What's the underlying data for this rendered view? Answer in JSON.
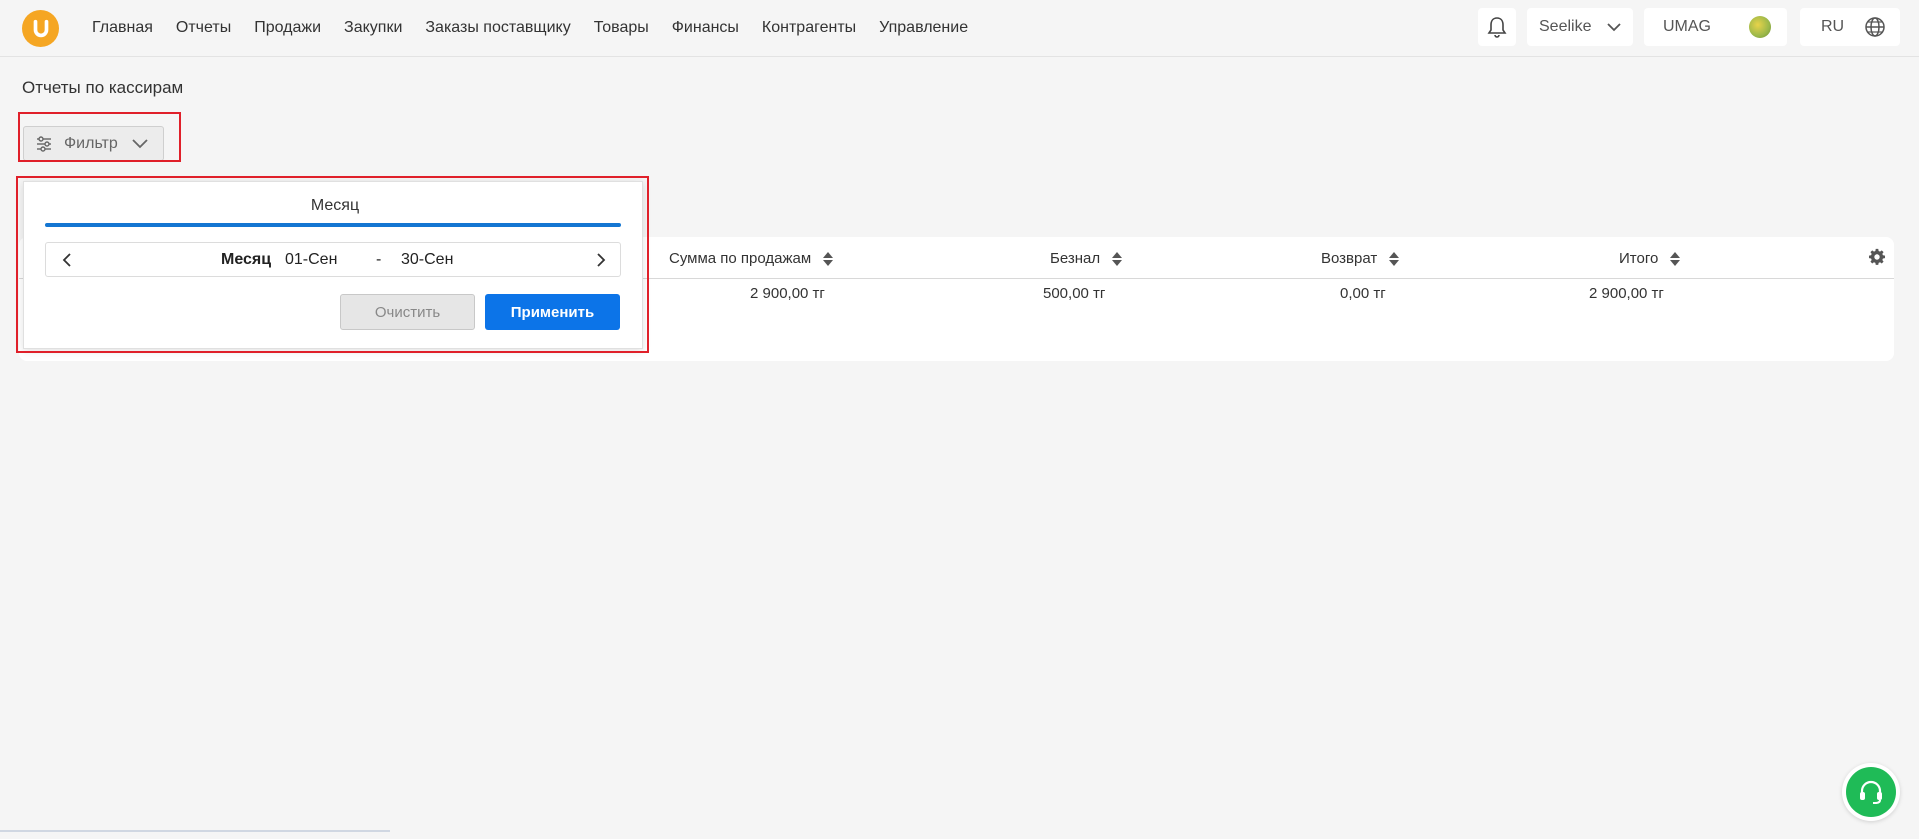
{
  "header": {
    "logo": "umag-logo",
    "nav": [
      "Главная",
      "Отчеты",
      "Продажи",
      "Закупки",
      "Заказы поставщику",
      "Товары",
      "Финансы",
      "Контрагенты",
      "Управление"
    ],
    "store_label": "Seelike",
    "account_label": "UMAG",
    "language_label": "RU"
  },
  "page": {
    "title": "Отчеты по кассирам"
  },
  "filter": {
    "button_label": "Фильтр"
  },
  "popover": {
    "tab_title": "Месяц",
    "period_label": "Месяц",
    "date_from": "01-Сен",
    "date_separator": "-",
    "date_to": "30-Сен",
    "clear_label": "Очистить",
    "apply_label": "Применить"
  },
  "table": {
    "columns": [
      "Сумма по продажам",
      "Безнал",
      "Возврат",
      "Итого"
    ],
    "rows": [
      [
        "2 900,00 тг",
        "500,00 тг",
        "0,00 тг",
        "2 900,00 тг"
      ]
    ]
  },
  "colors": {
    "accent": "#0c74e8",
    "logo": "#f5a623",
    "support": "#1fbb57",
    "highlight": "#e0202a"
  }
}
